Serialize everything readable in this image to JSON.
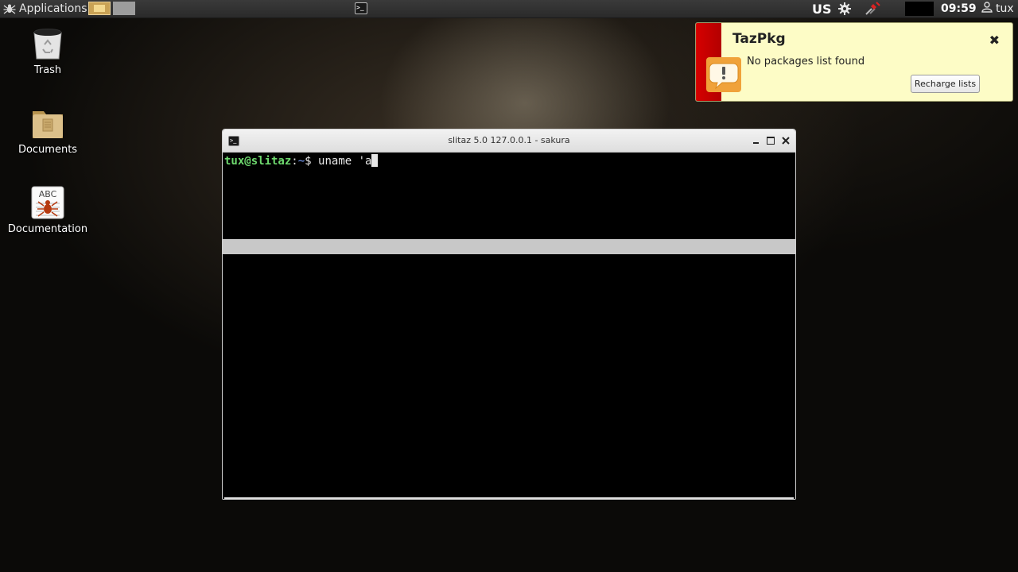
{
  "panel": {
    "applications_label": "Applications",
    "keyboard_layout": "US",
    "clock": "09:59",
    "user": "tux"
  },
  "desktop": {
    "icons": [
      {
        "label": "Trash"
      },
      {
        "label": "Documents"
      },
      {
        "label": "Documentation",
        "badge": "ABC"
      }
    ]
  },
  "notification": {
    "title": "TazPkg",
    "message": "No packages list found",
    "button_label": "Recharge lists",
    "close_glyph": "✖",
    "accent_color": "#d60000",
    "background_color": "#fdfcc6"
  },
  "terminal": {
    "title": "slitaz 5.0 127.0.0.1  - sakura",
    "prompt_user_host": "tux@slitaz",
    "prompt_colon": ":",
    "prompt_path": "~",
    "prompt_symbol": "$ ",
    "command": "uname 'a",
    "prompt_user_color": "#6ed96e",
    "prompt_path_color": "#7aa2ff"
  }
}
